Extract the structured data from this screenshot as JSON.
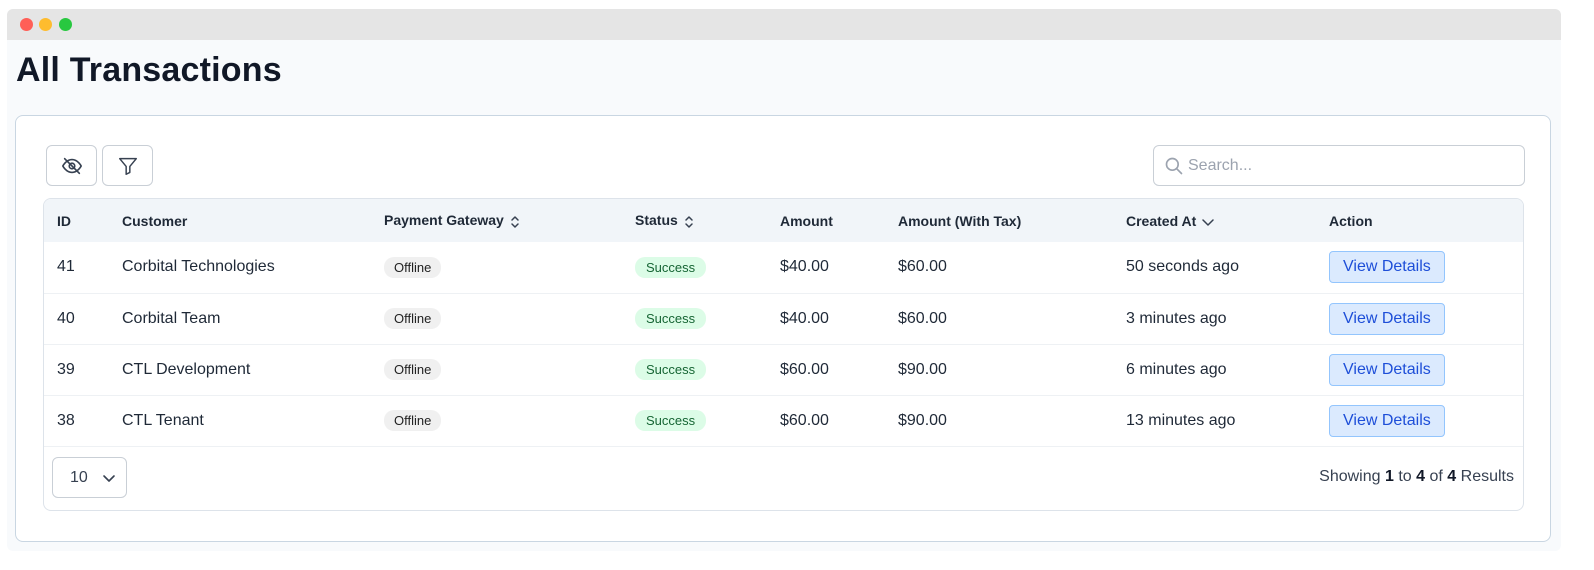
{
  "page": {
    "title": "All Transactions"
  },
  "toolbar": {
    "toggle_columns_icon": "eye-off-icon",
    "filter_icon": "filter-icon",
    "search_placeholder": "Search...",
    "search_value": ""
  },
  "table": {
    "columns": [
      {
        "label": "ID",
        "sortable": false
      },
      {
        "label": "Customer",
        "sortable": false
      },
      {
        "label": "Payment Gateway",
        "sortable": true,
        "sort": "none"
      },
      {
        "label": "Status",
        "sortable": true,
        "sort": "none"
      },
      {
        "label": "Amount",
        "sortable": false
      },
      {
        "label": "Amount (With Tax)",
        "sortable": false
      },
      {
        "label": "Created At",
        "sortable": true,
        "sort": "desc"
      },
      {
        "label": "Action",
        "sortable": false
      }
    ],
    "rows": [
      {
        "id": "41",
        "customer": "Corbital Technologies",
        "gateway": "Offline",
        "status": "Success",
        "amount": "$40.00",
        "amount_tax": "$60.00",
        "created": "50 seconds ago",
        "action": "View Details"
      },
      {
        "id": "40",
        "customer": "Corbital Team",
        "gateway": "Offline",
        "status": "Success",
        "amount": "$40.00",
        "amount_tax": "$60.00",
        "created": "3 minutes ago",
        "action": "View Details"
      },
      {
        "id": "39",
        "customer": "CTL Development",
        "gateway": "Offline",
        "status": "Success",
        "amount": "$60.00",
        "amount_tax": "$90.00",
        "created": "6 minutes ago",
        "action": "View Details"
      },
      {
        "id": "38",
        "customer": "CTL Tenant",
        "gateway": "Offline",
        "status": "Success",
        "amount": "$60.00",
        "amount_tax": "$90.00",
        "created": "13 minutes ago",
        "action": "View Details"
      }
    ]
  },
  "pagination": {
    "page_size": "10",
    "showing_prefix": "Showing",
    "from": "1",
    "to_word": "to",
    "to": "4",
    "of_word": "of",
    "total": "4",
    "results_word": "Results"
  },
  "colors": {
    "accent": "#1d4ed8",
    "success_bg": "#dcfce7",
    "success_text": "#166534"
  }
}
